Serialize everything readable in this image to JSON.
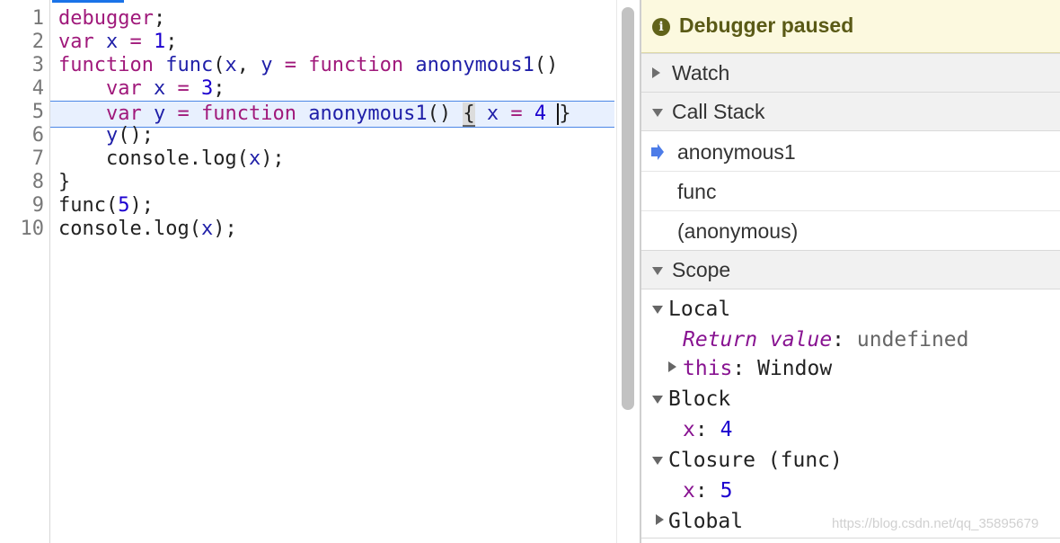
{
  "editor": {
    "line_numbers": [
      "1",
      "2",
      "3",
      "4",
      "5",
      "6",
      "7",
      "8",
      "9",
      "10"
    ],
    "lines": {
      "l1": {
        "kw": "debugger",
        "p": ";"
      },
      "l2": {
        "kw": "var",
        "sp": " ",
        "v": "x",
        "eq": " = ",
        "n": "1",
        "p": ";"
      },
      "l3": {
        "kw1": "function",
        "sp1": " ",
        "fn": "func",
        "p1": "(",
        "v1": "x",
        "c": ", ",
        "v2": "y",
        "eq": " = ",
        "kw2": "function",
        "sp2": " ",
        "fn2": "anonymous1",
        "p2": "()"
      },
      "l4": {
        "ind": "    ",
        "kw": "var",
        "sp": " ",
        "v": "x",
        "eq": " = ",
        "n": "3",
        "p": ";"
      },
      "l5": {
        "ind": "    ",
        "kw1": "var",
        "sp1": " ",
        "v1": "y",
        "eq1": " = ",
        "kw2": "function",
        "sp2": " ",
        "fn": "anonymous1",
        "p1": "() ",
        "ob": "{",
        "sp3": " ",
        "v2": "x",
        "eq2": " = ",
        "n": "4",
        "sp4": " ",
        "cb": "}"
      },
      "l6": {
        "ind": "    ",
        "v": "y",
        "p": "();"
      },
      "l7": {
        "ind": "    ",
        "a": "console.log(",
        "v": "x",
        "p": ");"
      },
      "l8": {
        "p": "}"
      },
      "l9": {
        "a": "func(",
        "n": "5",
        "p": ");"
      },
      "l10": {
        "a": "console.log(",
        "v": "x",
        "p": ");"
      }
    }
  },
  "sidebar": {
    "banner": {
      "icon": "info-icon",
      "text": "Debugger paused"
    },
    "watch": {
      "label": "Watch"
    },
    "call_stack": {
      "label": "Call Stack",
      "frames": [
        "anonymous1",
        "func",
        "(anonymous)"
      ]
    },
    "scope": {
      "label": "Scope",
      "local": {
        "label": "Local",
        "return_name": "Return value",
        "return_value": "undefined",
        "this_name": "this",
        "this_value": "Window"
      },
      "block": {
        "label": "Block",
        "x_name": "x",
        "x_value": "4"
      },
      "closure": {
        "label": "Closure (func)",
        "x_name": "x",
        "x_value": "5"
      },
      "global": {
        "label": "Global"
      },
      "colon": ": "
    }
  },
  "watermark": "https://blog.csdn.net/qq_35895679",
  "colors": {
    "keyword": "#a0197b",
    "variable": "#1f1fa8",
    "number": "#1c00cf",
    "accent": "#1a73e8",
    "banner_bg": "#fcf9df"
  }
}
